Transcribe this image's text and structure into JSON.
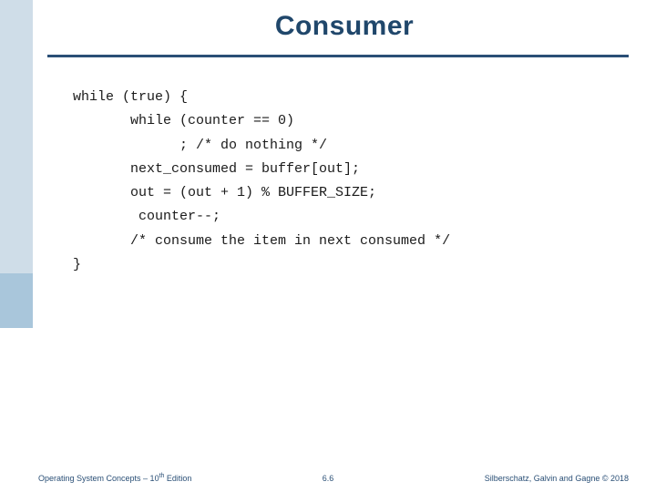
{
  "title": "Consumer",
  "code": {
    "l1": "while (true) {",
    "l2": "       while (counter == 0)",
    "l3": "             ; /* do nothing */",
    "l4": "       next_consumed = buffer[out];",
    "l5": "       out = (out + 1) % BUFFER_SIZE;",
    "l6": "        counter--;",
    "l7": "       /* consume the item in next consumed */",
    "l8": "}"
  },
  "footer": {
    "left_prefix": "Operating System Concepts – 10",
    "left_sup": "th",
    "left_suffix": " Edition",
    "center": "6.6",
    "right": "Silberschatz, Galvin and Gagne © 2018"
  }
}
